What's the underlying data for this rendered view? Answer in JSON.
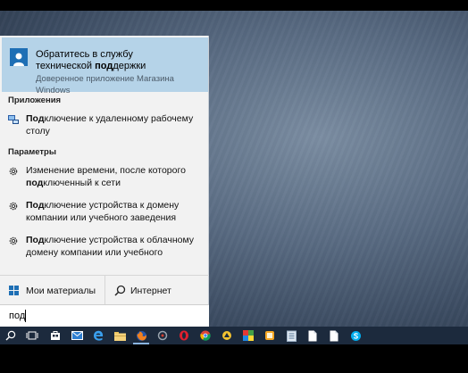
{
  "best_match": {
    "title_line1": "Обратитесь в службу",
    "title_line2_pre": "технической ",
    "title_line2_bold": "под",
    "title_line2_post": "держки",
    "subtitle": "Доверенное приложение Магазина Windows"
  },
  "sections": {
    "apps_title": "Приложения",
    "settings_title": "Параметры"
  },
  "apps": [
    {
      "bold": "Под",
      "rest": "ключение к удаленному рабочему столу"
    }
  ],
  "settings": [
    {
      "pre": "Изменение времени, после которого ",
      "bold": "под",
      "post": "ключенный к сети"
    },
    {
      "pre": "",
      "bold": "Под",
      "post": "ключение устройства к домену компании или учебного заведения"
    },
    {
      "pre": "",
      "bold": "Под",
      "post": "ключение устройства к облачному домену компании или учебного"
    }
  ],
  "bottom": {
    "my_stuff_label": "Мои материалы",
    "web_label": "Интернет"
  },
  "search": {
    "query": "под"
  },
  "colors": {
    "accent_highlight": "#b5d3e8",
    "taskbar": "#1c2a3d",
    "icon_blue": "#1e6fb5"
  },
  "taskbar_icons": [
    "search-icon",
    "task-view-icon",
    "store-icon",
    "mail-icon",
    "edge-icon",
    "file-explorer-icon",
    "firefox-icon",
    "app-icon",
    "opera-icon",
    "chrome-icon",
    "app-icon",
    "paint-icon",
    "app-icon",
    "notepad-icon",
    "document-icon",
    "document-icon",
    "skype-icon"
  ]
}
